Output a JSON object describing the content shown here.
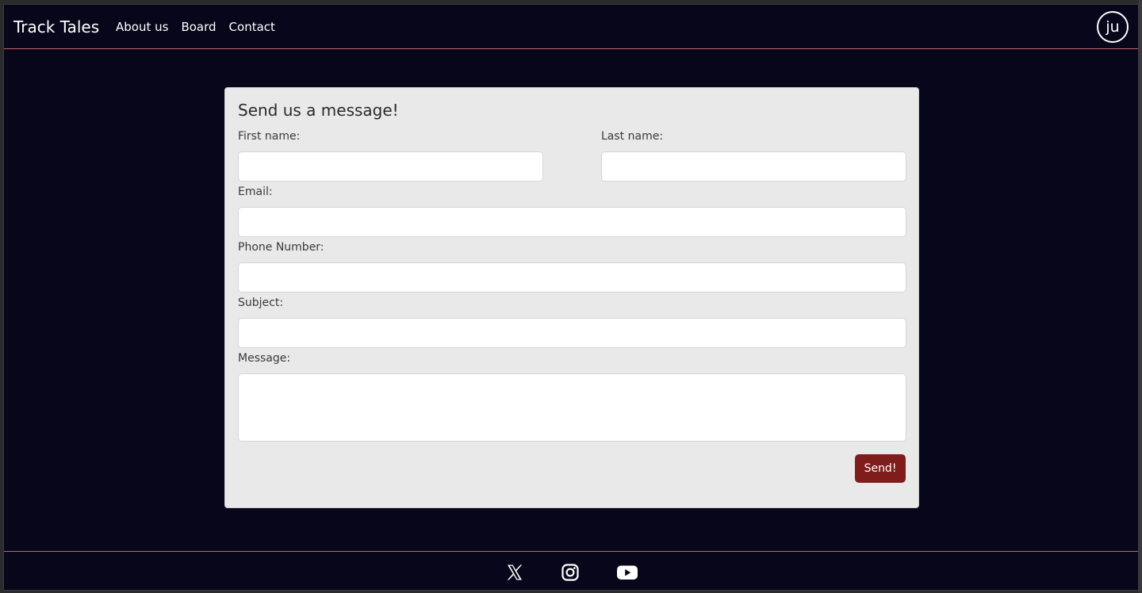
{
  "navbar": {
    "brand": "Track Tales",
    "links": [
      "About us",
      "Board",
      "Contact"
    ],
    "avatar_initials": "ju"
  },
  "form": {
    "title": "Send us a message!",
    "first_name_label": "First name:",
    "last_name_label": "Last name:",
    "email_label": "Email:",
    "phone_label": "Phone Number:",
    "subject_label": "Subject:",
    "message_label": "Message:",
    "first_name_value": "",
    "last_name_value": "",
    "email_value": "",
    "phone_value": "",
    "subject_value": "",
    "message_value": "",
    "send_label": "Send!"
  },
  "footer": {
    "icons": [
      "x-twitter-icon",
      "instagram-icon",
      "youtube-icon"
    ]
  },
  "colors": {
    "background": "#07061a",
    "divider": "#c9676c",
    "card": "#e9e9e9",
    "button": "#7f1d1d"
  }
}
